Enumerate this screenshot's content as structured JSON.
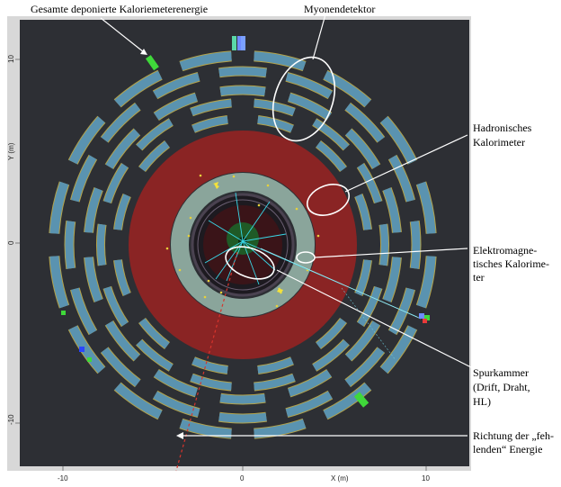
{
  "labels": {
    "calorimeter_energy": "Gesamte deponierte Kaloriemeterenergie",
    "muon_detector": "Myonendetektor",
    "hadronic_calorimeter": [
      "Hadronisches",
      "Kalorimeter"
    ],
    "em_calorimeter": [
      "Elektromagne-",
      "tisches Kalorime-",
      "ter"
    ],
    "tracker": [
      "Spurkammer",
      "(Drift, Draht,",
      "HL)"
    ],
    "missing_energy": [
      "Richtung der „feh-",
      "lenden“ Energie"
    ]
  },
  "axes": {
    "x_label": "X (m)",
    "y_label": "Y (m)",
    "x_ticks": [
      "-10",
      "0",
      "10"
    ],
    "y_ticks": [
      "10",
      "0",
      "-10"
    ]
  },
  "colors": {
    "background": "#2d2f34",
    "muon_chamber": "#5a93b0",
    "muon_outline": "#b3a24a",
    "hadronic": "#8a2424",
    "em": "#8aa59b",
    "tracker": "#2a2228",
    "track": "#39d8e8",
    "missing_energy": "#d8342c",
    "energy_tower": "#3fd83a",
    "highlight": "#ffffff"
  }
}
